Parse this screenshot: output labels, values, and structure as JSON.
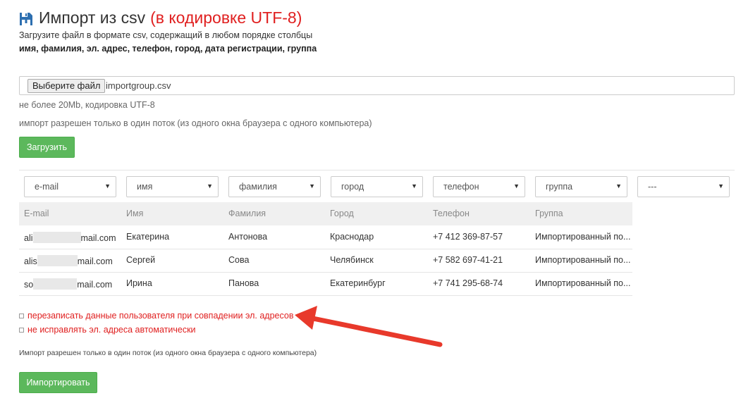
{
  "header": {
    "title": "Импорт из csv",
    "title_red": "(в кодировке UTF-8)",
    "description": "Загрузите файл в формате csv, содержащий в любом порядке столбцы",
    "columns_required": "имя, фамилия, эл. адрес, телефон, город, дата регистрации, группа"
  },
  "upload": {
    "choose_button": "Выберите файл",
    "file_name": "importgroup.csv",
    "limit_hint": "не более 20Mb, кодировка UTF-8",
    "thread_hint": "импорт разрешен только в один поток (из одного окна браузера с одного компьютера)",
    "upload_button": "Загрузить"
  },
  "mapping_selects": [
    {
      "value": "e-mail"
    },
    {
      "value": "имя"
    },
    {
      "value": "фамилия"
    },
    {
      "value": "город"
    },
    {
      "value": "телефон"
    },
    {
      "value": "группа"
    },
    {
      "value": "---"
    }
  ],
  "table": {
    "headers": [
      "E-mail",
      "Имя",
      "Фамилия",
      "Город",
      "Телефон",
      "Группа"
    ],
    "rows": [
      {
        "email_start": "ali",
        "email_end": "mail.com",
        "first": "Екатерина",
        "last": "Антонова",
        "city": "Краснодар",
        "phone": "+7 412 369-87-57",
        "group": "Импортированный по..."
      },
      {
        "email_start": "alis",
        "email_end": "mail.com",
        "first": "Сергей",
        "last": "Сова",
        "city": "Челябинск",
        "phone": "+7 582 697-41-21",
        "group": "Импортированный по..."
      },
      {
        "email_start": "so",
        "email_end": "mail.com",
        "first": "Ирина",
        "last": "Панова",
        "city": "Екатеринбург",
        "phone": "+7 741 295-68-74",
        "group": "Импортированный по..."
      }
    ]
  },
  "options": {
    "overwrite": "перезаписать данные пользователя при совпадении эл. адресов",
    "no_fix_emails": "не исправлять эл. адреса автоматически"
  },
  "footer": {
    "note": "Импорт разрешен только в один поток (из одного окна браузера с одного компьютера)",
    "import_button": "Импортировать"
  },
  "colors": {
    "accent_green": "#5cb85c",
    "accent_red": "#e02020",
    "icon_blue": "#2d6fb0"
  },
  "icons": {
    "title_icon": "floppy-upload-icon",
    "select_arrow": "caret-down-icon",
    "annotation": "red-arrow-annotation"
  }
}
